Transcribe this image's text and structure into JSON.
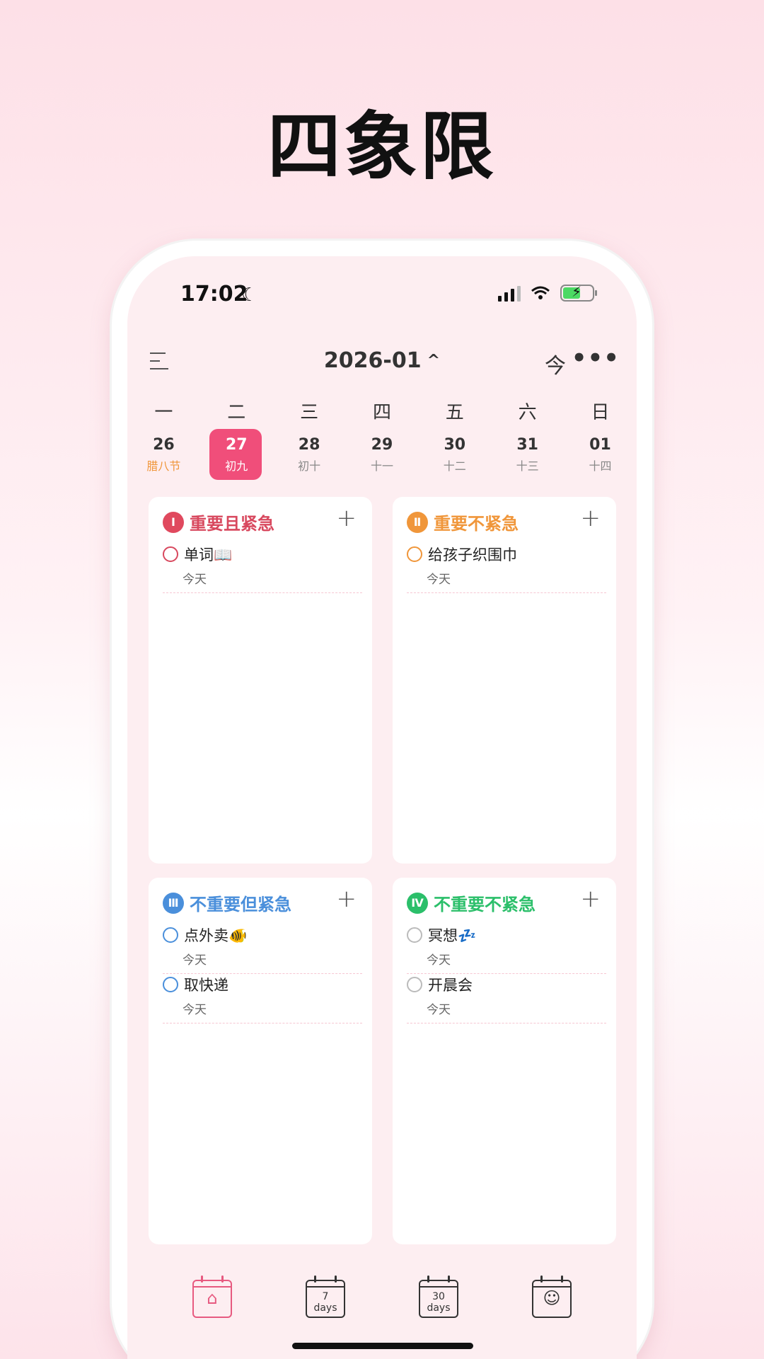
{
  "headline": "四象限",
  "status_bar": {
    "time": "17:02",
    "moon": "☾"
  },
  "header": {
    "month": "2026-01",
    "chevron": "^",
    "today_label": "今",
    "more_label": "•••"
  },
  "weekdays": [
    "一",
    "二",
    "三",
    "四",
    "五",
    "六",
    "日"
  ],
  "dates": [
    {
      "num": "26",
      "lunar": "腊八节"
    },
    {
      "num": "27",
      "lunar": "初九"
    },
    {
      "num": "28",
      "lunar": "初十"
    },
    {
      "num": "29",
      "lunar": "十一"
    },
    {
      "num": "30",
      "lunar": "十二"
    },
    {
      "num": "31",
      "lunar": "十三"
    },
    {
      "num": "01",
      "lunar": "十四"
    }
  ],
  "quadrants": [
    {
      "badge": "Ⅰ",
      "title": "重要且紧急",
      "tasks": [
        {
          "title": "单词📖",
          "sub": "今天"
        }
      ]
    },
    {
      "badge": "Ⅱ",
      "title": "重要不紧急",
      "tasks": [
        {
          "title": "给孩子织围巾",
          "sub": "今天"
        }
      ]
    },
    {
      "badge": "Ⅲ",
      "title": "不重要但紧急",
      "tasks": [
        {
          "title": "点外卖🐠",
          "sub": "今天"
        },
        {
          "title": "取快递",
          "sub": "今天"
        }
      ]
    },
    {
      "badge": "Ⅳ",
      "title": "不重要不紧急",
      "tasks": [
        {
          "title": "冥想💤",
          "sub": "今天"
        },
        {
          "title": "开晨会",
          "sub": "今天"
        }
      ]
    }
  ],
  "tabbar": [
    {
      "icon": "home-calendar-icon",
      "glyph": "⌂"
    },
    {
      "icon": "seven-days-icon",
      "line1": "7",
      "line2": "days"
    },
    {
      "icon": "thirty-days-icon",
      "line1": "30",
      "line2": "days"
    },
    {
      "icon": "smiley-calendar-icon",
      "glyph": "☺"
    }
  ],
  "colors": {
    "accent": "#f04e7a",
    "q1": "#d8485e",
    "q2": "#f0963a",
    "q3": "#4a8fdb",
    "q4": "#2bbf6a"
  }
}
